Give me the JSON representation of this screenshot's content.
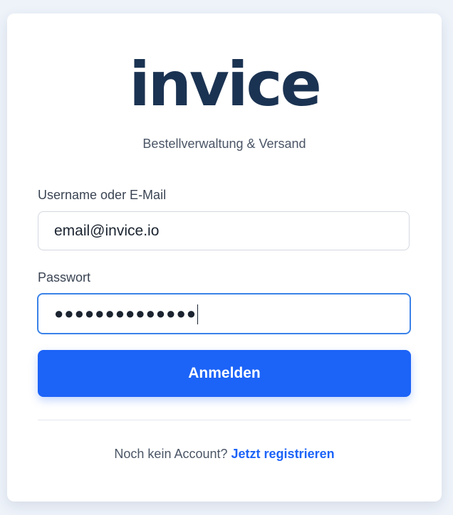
{
  "brand": {
    "logo_text": "invice",
    "subtitle": "Bestellverwaltung & Versand"
  },
  "form": {
    "username_label": "Username oder E-Mail",
    "username_value": "email@invice.io",
    "password_label": "Passwort",
    "password_masked": "●●●●●●●●●●●●●●",
    "submit_label": "Anmelden"
  },
  "footer": {
    "prompt": "Noch kein Account?",
    "register_link": "Jetzt registrieren"
  },
  "colors": {
    "page_bg": "#eef3fa",
    "logo": "#1b3352",
    "primary": "#1c63f7",
    "focus_border": "#3a82e8"
  }
}
